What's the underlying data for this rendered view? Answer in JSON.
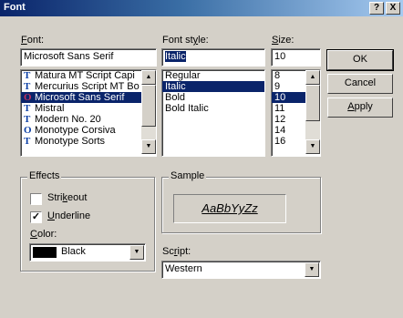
{
  "window": {
    "title": "Font",
    "help_button": "?",
    "close_button": "X"
  },
  "font": {
    "label": "Font:",
    "value": "Microsoft Sans Serif",
    "list": [
      {
        "icon": "truetype-icon",
        "glyph": "T",
        "name": "Matura MT Script Capi",
        "selected": false
      },
      {
        "icon": "truetype-icon",
        "glyph": "T",
        "name": "Mercurius Script MT Bo",
        "selected": false
      },
      {
        "icon": "opentype-icon",
        "glyph": "O",
        "name": "Microsoft Sans Serif",
        "selected": true
      },
      {
        "icon": "truetype-icon",
        "glyph": "T",
        "name": "Mistral",
        "selected": false
      },
      {
        "icon": "truetype-icon",
        "glyph": "T",
        "name": "Modern No. 20",
        "selected": false
      },
      {
        "icon": "opentype-icon",
        "glyph": "O",
        "name": "Monotype Corsiva",
        "selected": false
      },
      {
        "icon": "truetype-icon",
        "glyph": "T",
        "name": "Monotype Sorts",
        "selected": false
      }
    ]
  },
  "style": {
    "label": "Font style:",
    "value": "Italic",
    "list": [
      {
        "name": "Regular",
        "selected": false
      },
      {
        "name": "Italic",
        "selected": true
      },
      {
        "name": "Bold",
        "selected": false
      },
      {
        "name": "Bold Italic",
        "selected": false
      }
    ]
  },
  "size": {
    "label": "Size:",
    "value": "10",
    "list": [
      {
        "name": "8",
        "selected": false
      },
      {
        "name": "9",
        "selected": false
      },
      {
        "name": "10",
        "selected": true
      },
      {
        "name": "11",
        "selected": false
      },
      {
        "name": "12",
        "selected": false
      },
      {
        "name": "14",
        "selected": false
      },
      {
        "name": "16",
        "selected": false
      }
    ]
  },
  "buttons": {
    "ok": "OK",
    "cancel": "Cancel",
    "apply": "Apply"
  },
  "effects": {
    "label": "Effects",
    "strikeout": {
      "label": "Strikeout",
      "checked": false
    },
    "underline": {
      "label": "Underline",
      "checked": true
    },
    "color_label": "Color:",
    "color_value": "Black",
    "color_swatch": "#000000"
  },
  "sample": {
    "label": "Sample",
    "text": "AaBbYyZz"
  },
  "script": {
    "label": "Script:",
    "value": "Western"
  },
  "colors": {
    "selection": "#0a246a",
    "face": "#d4d0c8"
  }
}
